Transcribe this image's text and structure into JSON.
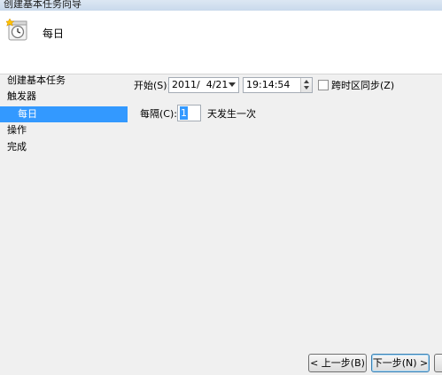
{
  "window": {
    "title": "创建基本任务向导"
  },
  "header": {
    "title": "每日",
    "icon": "task-clock-icon"
  },
  "nav": {
    "items": [
      {
        "label": "创建基本任务",
        "active": false
      },
      {
        "label": "触发器",
        "active": false
      },
      {
        "label": "每日",
        "active": true
      },
      {
        "label": "操作",
        "active": false
      },
      {
        "label": "完成",
        "active": false
      }
    ]
  },
  "trigger": {
    "start_label": "开始(S):",
    "start_date": "2011/  4/21",
    "start_time": "19:14:54",
    "sync_timezones_label": "跨时区同步(Z)",
    "sync_timezones_checked": false,
    "recur_label": "每隔(C):",
    "recur_value": "1",
    "recur_suffix": "天发生一次"
  },
  "buttons": {
    "back": "< 上一步(B)",
    "next": "下一步(N) >"
  },
  "colors": {
    "selection": "#3399ff",
    "header_bg": "#ffffff",
    "body_bg": "#f0f0f0"
  }
}
